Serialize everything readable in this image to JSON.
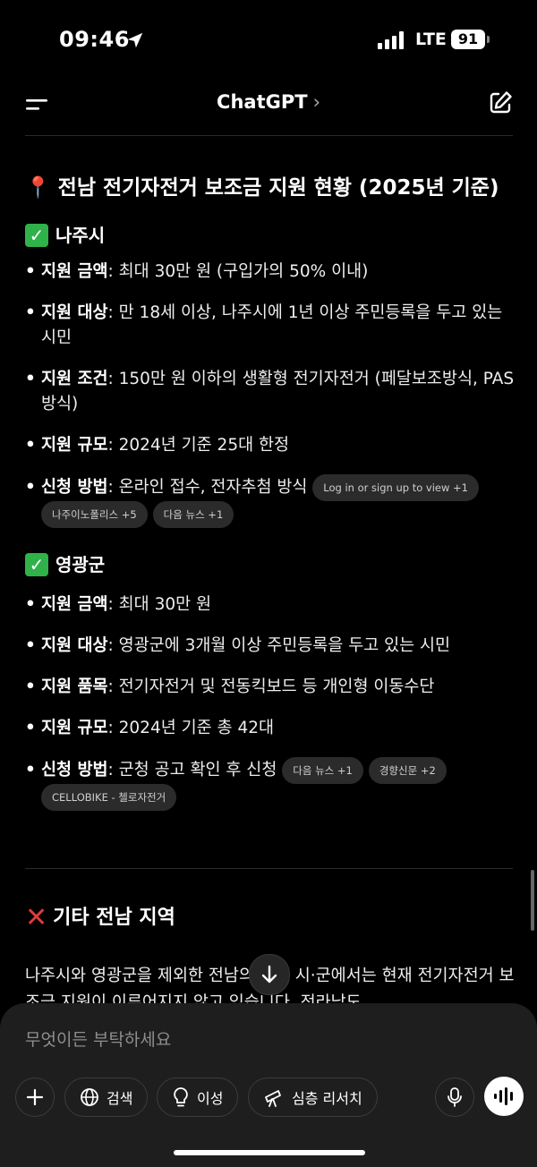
{
  "status": {
    "time": "09:46",
    "network": "LTE",
    "battery": "91"
  },
  "nav": {
    "title": "ChatGPT",
    "chevron": "›"
  },
  "article": {
    "heading": {
      "emoji": "📍",
      "text": "전남 전기자전거 보조금 지원 현황 (2025년 기준)"
    },
    "sections": [
      {
        "title": "나주시",
        "items": [
          {
            "label": "지원 금액",
            "text": ": 최대 30만 원 (구입가의 50% 이내)"
          },
          {
            "label": "지원 대상",
            "text": ": 만 18세 이상, 나주시에 1년 이상 주민등록을 두고 있는 시민"
          },
          {
            "label": "지원 조건",
            "text": ": 150만 원 이하의 생활형 전기자전거 (페달보조방식, PAS 방식)"
          },
          {
            "label": "지원 규모",
            "text": ": 2024년 기준 25대 한정"
          },
          {
            "label": "신청 방법",
            "text": ": 온라인 접수, 전자추첨 방식"
          }
        ],
        "chips": [
          "Log in or sign up to view +1",
          "나주이노폴리스 +5",
          "다음 뉴스 +1"
        ]
      },
      {
        "title": "영광군",
        "items": [
          {
            "label": "지원 금액",
            "text": ": 최대 30만 원"
          },
          {
            "label": "지원 대상",
            "text": ": 영광군에 3개월 이상 주민등록을 두고 있는 시민"
          },
          {
            "label": "지원 품목",
            "text": ": 전기자전거 및 전동킥보드 등 개인형 이동수단"
          },
          {
            "label": "지원 규모",
            "text": ": 2024년 기준 총 42대"
          },
          {
            "label": "신청 방법",
            "text": ": 군청 공고 확인 후 신청"
          }
        ],
        "chips": [
          "다음 뉴스 +1",
          "경향신문 +2",
          "CELLOBIKE - 첼로자전거"
        ]
      }
    ],
    "other": {
      "title": "기타 전남 지역",
      "text": "나주시와 영광군을 제외한 전남의 다른 시·군에서는 현재 전기자전거 보조금 지원이 이루어지지 않고 있습니다. 전라남도"
    }
  },
  "composer": {
    "placeholder": "무엇이든 부탁하세요",
    "buttons": {
      "search": "검색",
      "reason": "이성",
      "research": "심층 리서치"
    }
  }
}
